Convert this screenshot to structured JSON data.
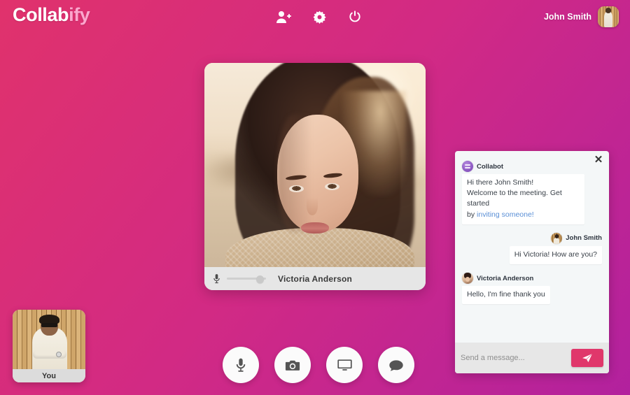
{
  "header": {
    "logo_main": "Collab",
    "logo_suffix": "ify",
    "actions": [
      {
        "name": "invite-user-icon",
        "label": "Invite user"
      },
      {
        "name": "settings-icon",
        "label": "Settings"
      },
      {
        "name": "power-icon",
        "label": "Leave meeting"
      }
    ],
    "user_name": "John Smith"
  },
  "video": {
    "participant_name": "Victoria Anderson",
    "mic_icon": "microphone-icon",
    "volume_value": 75
  },
  "selfview": {
    "label": "You"
  },
  "controls": [
    {
      "name": "toggle-microphone-button",
      "icon": "microphone-icon",
      "label": "Microphone"
    },
    {
      "name": "toggle-camera-button",
      "icon": "camera-icon",
      "label": "Camera"
    },
    {
      "name": "share-screen-button",
      "icon": "monitor-icon",
      "label": "Share screen"
    },
    {
      "name": "toggle-chat-button",
      "icon": "chat-bubble-icon",
      "label": "Chat"
    }
  ],
  "chat": {
    "close_label": "✕",
    "messages": [
      {
        "author": "Collabot",
        "avatar": "bot",
        "side": "in",
        "line1": "Hi there John Smith!",
        "line2": "Welcome to the meeting. Get started",
        "line3_prefix": "by ",
        "link": "inviting someone!"
      },
      {
        "author": "John Smith",
        "avatar": "john",
        "side": "out",
        "text": "Hi Victoria! How are you?"
      },
      {
        "author": "Victoria Anderson",
        "avatar": "victoria",
        "side": "in",
        "text": "Hello, I'm fine thank you"
      }
    ],
    "input_placeholder": "Send a message...",
    "input_value": "",
    "send_icon": "paper-plane-icon"
  },
  "colors": {
    "gradient_start": "#e0326c",
    "gradient_end": "#b2219e",
    "accent": "#e0376b",
    "link": "#5a8fd6",
    "logo_suffix": "#fba6cd"
  }
}
